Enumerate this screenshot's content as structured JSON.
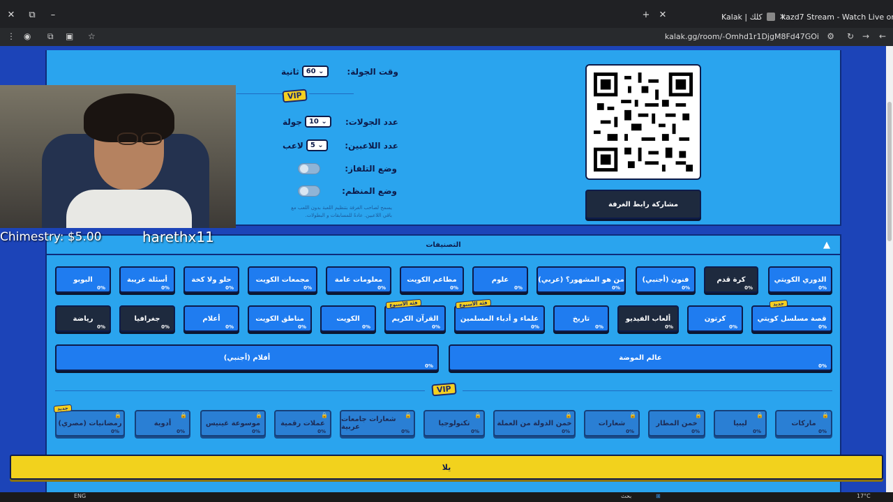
{
  "browser": {
    "tabs": [
      {
        "title": "Kalak | كلك"
      },
      {
        "title": "kazd7 Stream - Watch Live on"
      }
    ],
    "url": "kalak.gg/room/-Omhd1r1DjgM8Fd47GOi"
  },
  "settings": {
    "round_time_label": "وقت الجولة:",
    "round_time_value": "60",
    "round_time_unit": "ثانية",
    "vip_label": "VIP",
    "rounds_label": "عدد الجولات:",
    "rounds_value": "10",
    "rounds_unit": "جولة",
    "players_label": "عدد اللاعبين:",
    "players_value": "5",
    "players_unit": "لاعب",
    "tv_mode_label": "وضع التلفاز:",
    "organizer_mode_label": "وضع المنظم:",
    "organizer_hint": "يسمح لصاحب الغرفة بتنظيم اللعبة بدون اللعب مع باقي اللاعبين. عادةً للمسابقات و البطولات.",
    "share_label": "مشاركة رابط الغرفة"
  },
  "categories": {
    "title": "التصنيفات",
    "row1": [
      {
        "label": "الدوري الكويتي",
        "pct": "0%",
        "style": "blue"
      },
      {
        "label": "كرة قدم",
        "pct": "0%",
        "style": "dark"
      },
      {
        "label": "فنون (أجنبي)",
        "pct": "0%",
        "style": "blue"
      },
      {
        "label": "من هو المشهور؟ (عربي)",
        "pct": "0%",
        "style": "blue"
      },
      {
        "label": "علوم",
        "pct": "0%",
        "style": "blue"
      },
      {
        "label": "مطاعم الكويت",
        "pct": "0%",
        "style": "blue"
      },
      {
        "label": "معلومات عامة",
        "pct": "0%",
        "style": "blue"
      },
      {
        "label": "مجمعات الكويت",
        "pct": "0%",
        "style": "blue"
      },
      {
        "label": "حلو ولا كخة",
        "pct": "0%",
        "style": "blue"
      },
      {
        "label": "أسئلة غريبة",
        "pct": "0%",
        "style": "blue"
      },
      {
        "label": "البوبو",
        "pct": "0%",
        "style": "blue"
      }
    ],
    "row2": [
      {
        "label": "قصة مسلسل كويتي",
        "pct": "0%",
        "style": "blue",
        "badge": "جديد"
      },
      {
        "label": "كرتون",
        "pct": "0%",
        "style": "blue"
      },
      {
        "label": "ألعاب الفيديو",
        "pct": "0%",
        "style": "dark"
      },
      {
        "label": "تاريخ",
        "pct": "0%",
        "style": "blue"
      },
      {
        "label": "علماء و أدباء المسلمين",
        "pct": "0%",
        "style": "blue",
        "badge": "فئة الأسبوع"
      },
      {
        "label": "القرآن الكريم",
        "pct": "0%",
        "style": "blue",
        "badge": "فئة الأسبوع"
      },
      {
        "label": "الكويت",
        "pct": "0%",
        "style": "blue"
      },
      {
        "label": "مناطق الكويت",
        "pct": "0%",
        "style": "blue"
      },
      {
        "label": "أعلام",
        "pct": "0%",
        "style": "blue"
      },
      {
        "label": "جغرافيا",
        "pct": "0%",
        "style": "dark"
      },
      {
        "label": "رياضة",
        "pct": "0%",
        "style": "dark"
      }
    ],
    "row3": [
      {
        "label": "عالم الموضة",
        "pct": "0%"
      },
      {
        "label": "أفلام (أجنبي)",
        "pct": "0%"
      }
    ],
    "vip_label": "VIP",
    "vip_row": [
      {
        "label": "ماركات",
        "pct": "0%"
      },
      {
        "label": "ليبيا",
        "pct": "0%"
      },
      {
        "label": "خمن المطار",
        "pct": "0%"
      },
      {
        "label": "شعارات",
        "pct": "0%"
      },
      {
        "label": "خمن الدولة من العملة",
        "pct": "0%"
      },
      {
        "label": "تكنولوجيا",
        "pct": "0%"
      },
      {
        "label": "شعارات جامعات عربية",
        "pct": "0%"
      },
      {
        "label": "عملات رقمية",
        "pct": "0%"
      },
      {
        "label": "موسوعة غينيس",
        "pct": "0%"
      },
      {
        "label": "أدوية",
        "pct": "0%"
      },
      {
        "label": "رمضانيات (مصري)",
        "pct": "0%",
        "badge": "جديد"
      }
    ]
  },
  "start_label": "يلا",
  "overlay": {
    "donation": "Chimestry: $5.00",
    "username": "harethx11"
  },
  "taskbar": {
    "lang": "ENG",
    "search": "بحث",
    "temp": "17°C"
  }
}
